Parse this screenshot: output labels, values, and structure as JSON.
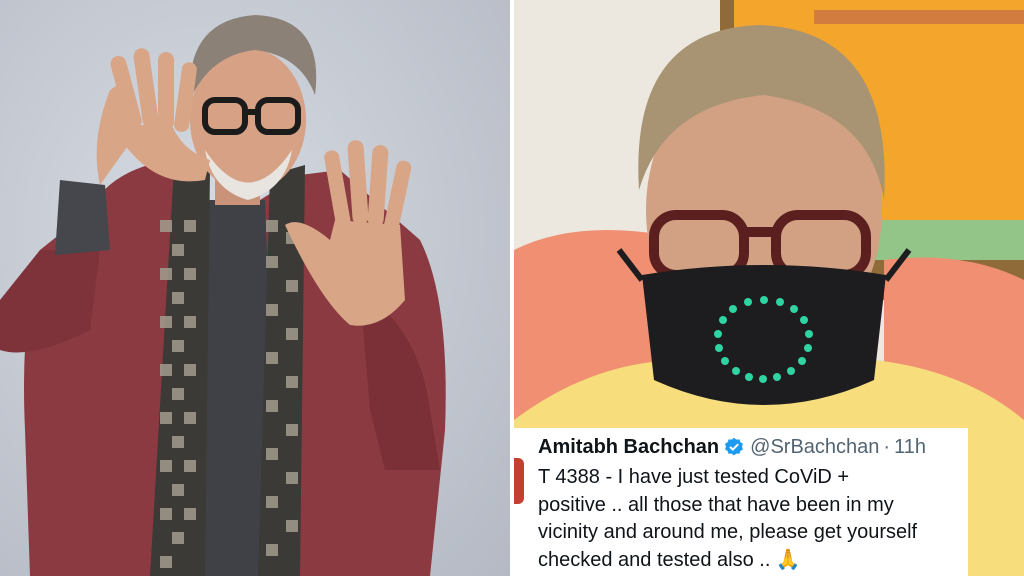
{
  "left_photo": {
    "subject": "man-in-maroon-blazer-framing-gesture",
    "background_color": "#c3c8d1",
    "blazer_color": "#8a3a40",
    "scarf_color": "#3b3a36"
  },
  "right_photo": {
    "subject": "man-wearing-led-face-mask",
    "cushion_color": "#f08f72",
    "mask_led_color": "#2fd4a2",
    "painting_color": "#f4a52c"
  },
  "tweet": {
    "name": "Amitabh Bachchan",
    "verified_icon": "verified-badge-icon",
    "handle": "@SrBachchan",
    "separator": "·",
    "time": "11h",
    "text": "T 4388 - I have just tested CoViD +\npositive  .. all those that have been in my\nvicinity and around me, please get yourself\nchecked and tested also .. 🙏"
  },
  "colors": {
    "verified_blue": "#1d9bf0",
    "text_dark": "#0f1419",
    "text_muted": "#536471"
  }
}
